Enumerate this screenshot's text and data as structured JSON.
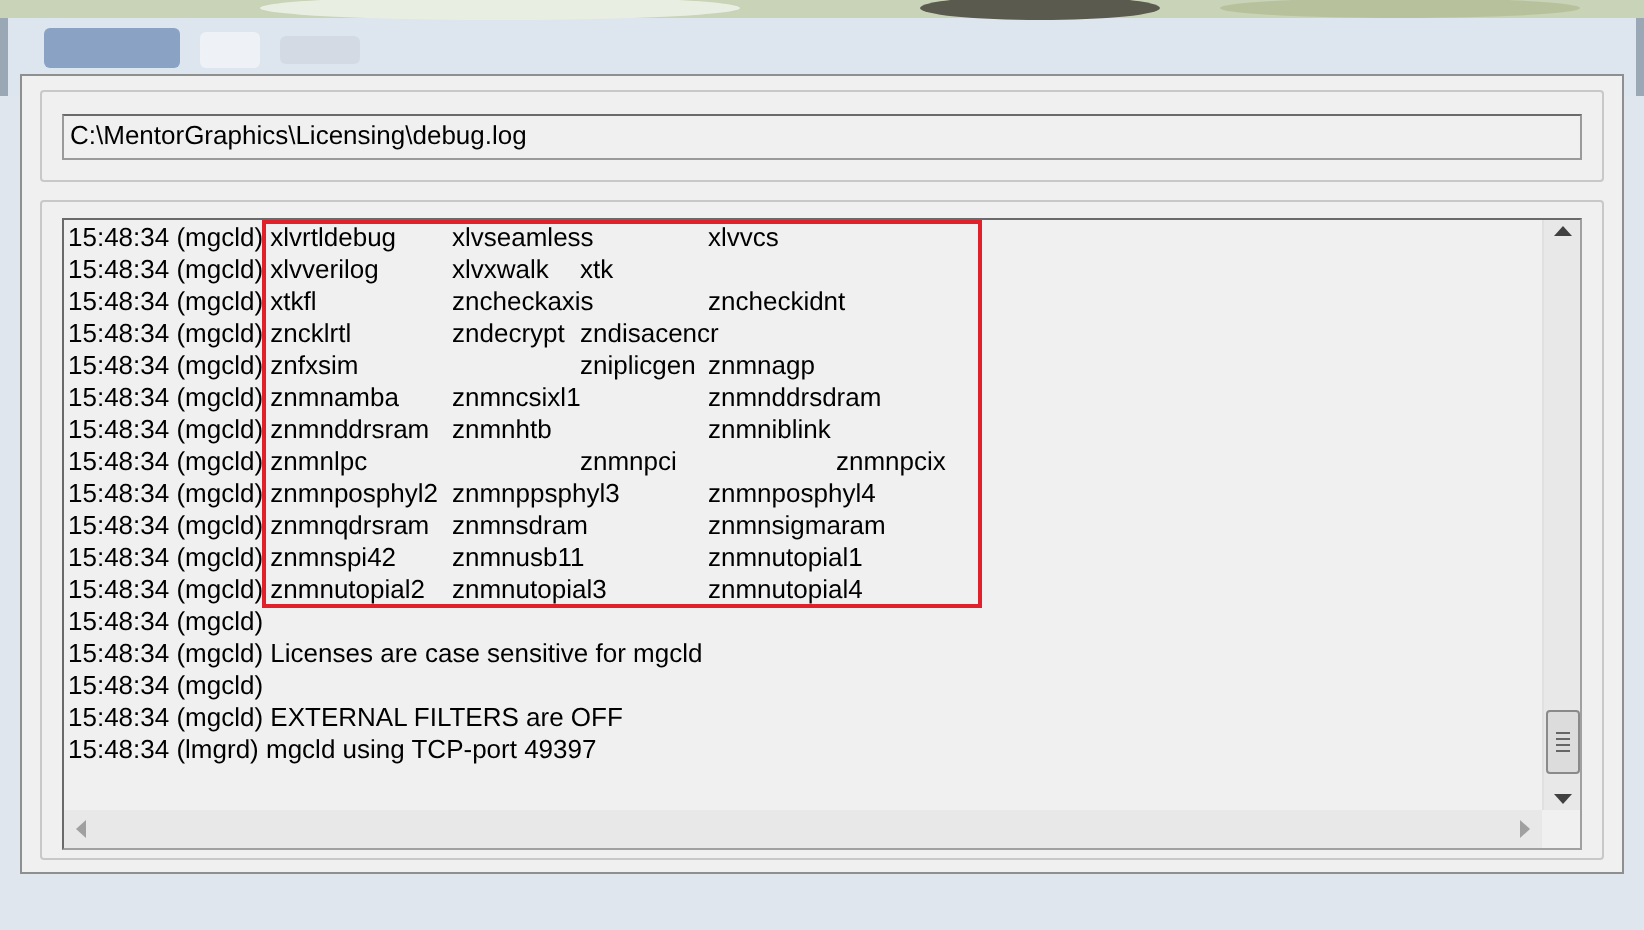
{
  "path_field": {
    "value": "C:\\MentorGraphics\\Licensing\\debug.log"
  },
  "log": {
    "lines": [
      "15:48:34 (mgcld) xlvrtldebug\txlvseamless\txlvvcs",
      "15:48:34 (mgcld) xlvverilog\txlvxwalk\txtk",
      "15:48:34 (mgcld) xtkfl\t\tzncheckaxis\tzncheckidnt",
      "15:48:34 (mgcld) zncklrtl\tzndecrypt\tzndisacencr",
      "15:48:34 (mgcld) znfxsim\t\tzniplicgen\tznmnagp",
      "15:48:34 (mgcld) znmnamba\tznmncsixl1\tznmnddrsdram",
      "15:48:34 (mgcld) znmnddrsram\tznmnhtb\t\tznmniblink",
      "15:48:34 (mgcld) znmnlpc\t\tznmnpci\t\tznmnpcix",
      "15:48:34 (mgcld) znmnposphyl2\tznmnppsphyl3\tznmnposphyl4",
      "15:48:34 (mgcld) znmnqdrsram\tznmnsdram\tznmnsigmaram",
      "15:48:34 (mgcld) znmnspi42\tznmnusb11\tznmnutopial1",
      "15:48:34 (mgcld) znmnutopial2\tznmnutopial3\tznmnutopial4",
      "15:48:34 (mgcld)",
      "15:48:34 (mgcld) Licenses are case sensitive for mgcld",
      "15:48:34 (mgcld)",
      "15:48:34 (mgcld) EXTERNAL FILTERS are OFF",
      "15:48:34 (lmgrd) mgcld using TCP-port 49397"
    ]
  }
}
